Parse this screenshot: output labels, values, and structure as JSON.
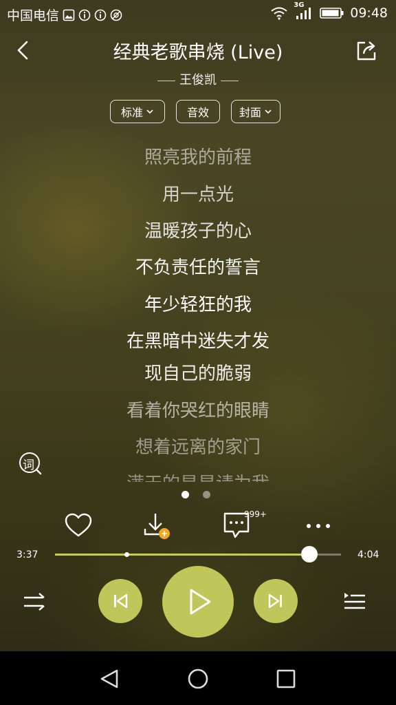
{
  "status_bar": {
    "carrier": "中国电信",
    "network": "3G",
    "time": "09:48"
  },
  "header": {
    "title": "经典老歌串烧 (Live)",
    "artist": "王俊凯"
  },
  "chips": [
    {
      "label": "标准",
      "dropdown": true
    },
    {
      "label": "音效",
      "dropdown": false
    },
    {
      "label": "封面",
      "dropdown": true
    }
  ],
  "lyrics": [
    {
      "text": "照亮我的前程",
      "opacity": 0.55
    },
    {
      "text": "用一点光",
      "opacity": 0.75
    },
    {
      "text": "温暖孩子的心",
      "opacity": 0.85
    },
    {
      "text": "不负责任的誓言",
      "opacity": 0.95
    },
    {
      "text": "年少轻狂的我",
      "opacity": 1.0
    },
    {
      "text": "在黑暗中迷失才发",
      "opacity": 0.95
    },
    {
      "text": "现自己的脆弱",
      "opacity": 0.9
    },
    {
      "text": "看着你哭红的眼睛",
      "opacity": 0.6
    },
    {
      "text": "想着远离的家门",
      "opacity": 0.5
    },
    {
      "text": "满天的星星请为我",
      "opacity": 0.45
    }
  ],
  "lyrics_toggle_label": "词",
  "pager": {
    "count": 2,
    "active": 0
  },
  "actions": {
    "comment_count": "999+"
  },
  "playback": {
    "current_time": "3:37",
    "total_time": "4:04",
    "progress_fraction": 0.89
  },
  "colors": {
    "accent": "#c1c65a",
    "progress": "#c5cc5a"
  },
  "icons": {
    "back": "chevron-left-icon",
    "share": "share-icon",
    "like": "heart-icon",
    "download": "download-icon",
    "comment": "comment-icon",
    "more": "more-icon",
    "play_mode": "shuffle-icon",
    "prev": "previous-icon",
    "play": "play-icon",
    "next": "next-icon",
    "playlist": "playlist-icon"
  }
}
